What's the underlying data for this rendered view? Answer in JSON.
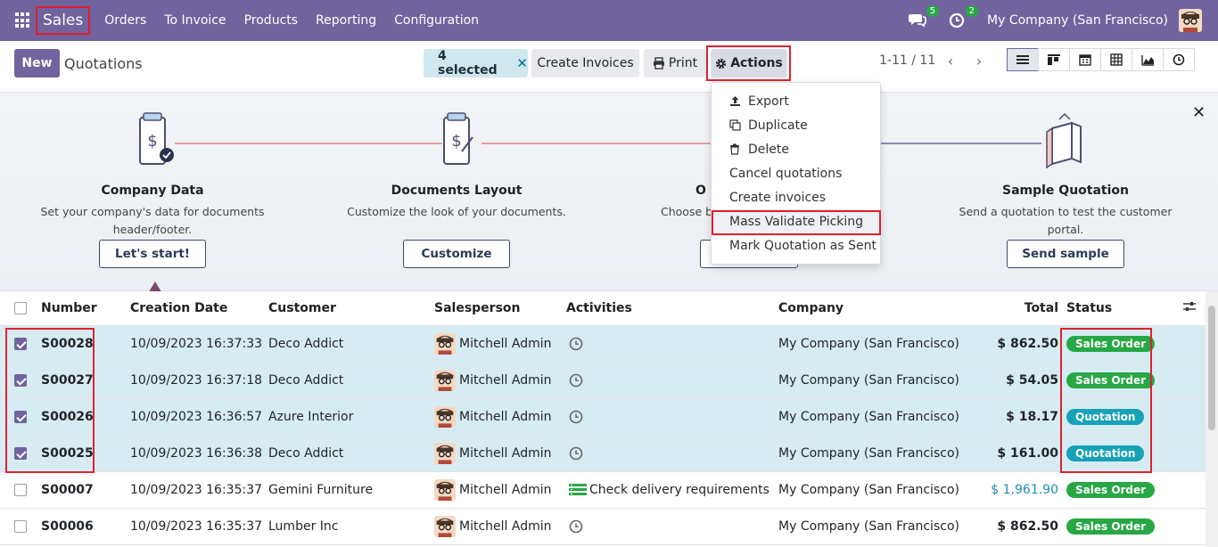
{
  "topbar": {
    "app_name": "Sales",
    "menu": [
      "Orders",
      "To Invoice",
      "Products",
      "Reporting",
      "Configuration"
    ],
    "messages_count": "5",
    "activities_count": "2",
    "company": "My Company (San Francisco)"
  },
  "control": {
    "new_label": "New",
    "title": "Quotations",
    "selected_label": "4 selected",
    "create_invoices_label": "Create Invoices",
    "print_label": "Print",
    "actions_label": "Actions",
    "pager": "1-11 / 11"
  },
  "actions_menu": [
    {
      "label": "Export",
      "icon": "upload-icon"
    },
    {
      "label": "Duplicate",
      "icon": "copy-icon"
    },
    {
      "label": "Delete",
      "icon": "trash-icon"
    },
    {
      "label": "Cancel quotations",
      "icon": ""
    },
    {
      "label": "Create invoices",
      "icon": ""
    },
    {
      "label": "Mass Validate Picking",
      "icon": ""
    },
    {
      "label": "Mark Quotation as Sent",
      "icon": ""
    }
  ],
  "onboarding": {
    "steps": [
      {
        "title": "Company Data",
        "desc": "Set your company's data for documents header/footer.",
        "button": "Let's start!"
      },
      {
        "title": "Documents Layout",
        "desc": "Customize the look of your documents.",
        "button": "Customize"
      },
      {
        "title": "O",
        "desc": "Choose b",
        "button": ""
      },
      {
        "title": "Sample Quotation",
        "desc": "Send a quotation to test the customer portal.",
        "button": "Send sample"
      }
    ]
  },
  "table": {
    "headers": {
      "number": "Number",
      "date": "Creation Date",
      "customer": "Customer",
      "salesperson": "Salesperson",
      "activities": "Activities",
      "company": "Company",
      "total": "Total",
      "status": "Status"
    },
    "rows": [
      {
        "selected": true,
        "number": "S00028",
        "date": "10/09/2023 16:37:33",
        "customer": "Deco Addict",
        "salesperson": "Mitchell Admin",
        "activity": "",
        "company": "My Company (San Francisco)",
        "total": "$ 862.50",
        "status": "Sales Order"
      },
      {
        "selected": true,
        "number": "S00027",
        "date": "10/09/2023 16:37:18",
        "customer": "Deco Addict",
        "salesperson": "Mitchell Admin",
        "activity": "",
        "company": "My Company (San Francisco)",
        "total": "$ 54.05",
        "status": "Sales Order"
      },
      {
        "selected": true,
        "number": "S00026",
        "date": "10/09/2023 16:36:57",
        "customer": "Azure Interior",
        "salesperson": "Mitchell Admin",
        "activity": "",
        "company": "My Company (San Francisco)",
        "total": "$ 18.17",
        "status": "Quotation"
      },
      {
        "selected": true,
        "number": "S00025",
        "date": "10/09/2023 16:36:38",
        "customer": "Deco Addict",
        "salesperson": "Mitchell Admin",
        "activity": "",
        "company": "My Company (San Francisco)",
        "total": "$ 161.00",
        "status": "Quotation"
      },
      {
        "selected": false,
        "number": "S00007",
        "date": "10/09/2023 16:35:37",
        "customer": "Gemini Furniture",
        "salesperson": "Mitchell Admin",
        "activity": "Check delivery requirements",
        "company": "My Company (San Francisco)",
        "total": "$ 1,961.90",
        "status": "Sales Order"
      },
      {
        "selected": false,
        "number": "S00006",
        "date": "10/09/2023 16:35:37",
        "customer": "Lumber Inc",
        "salesperson": "Mitchell Admin",
        "activity": "",
        "company": "My Company (San Francisco)",
        "total": "$ 862.50",
        "status": "Sales Order"
      }
    ]
  },
  "colors": {
    "brand": "#71639e",
    "sales_order": "#28a745",
    "quotation": "#17a2b8",
    "highlight": "#e0202e"
  }
}
